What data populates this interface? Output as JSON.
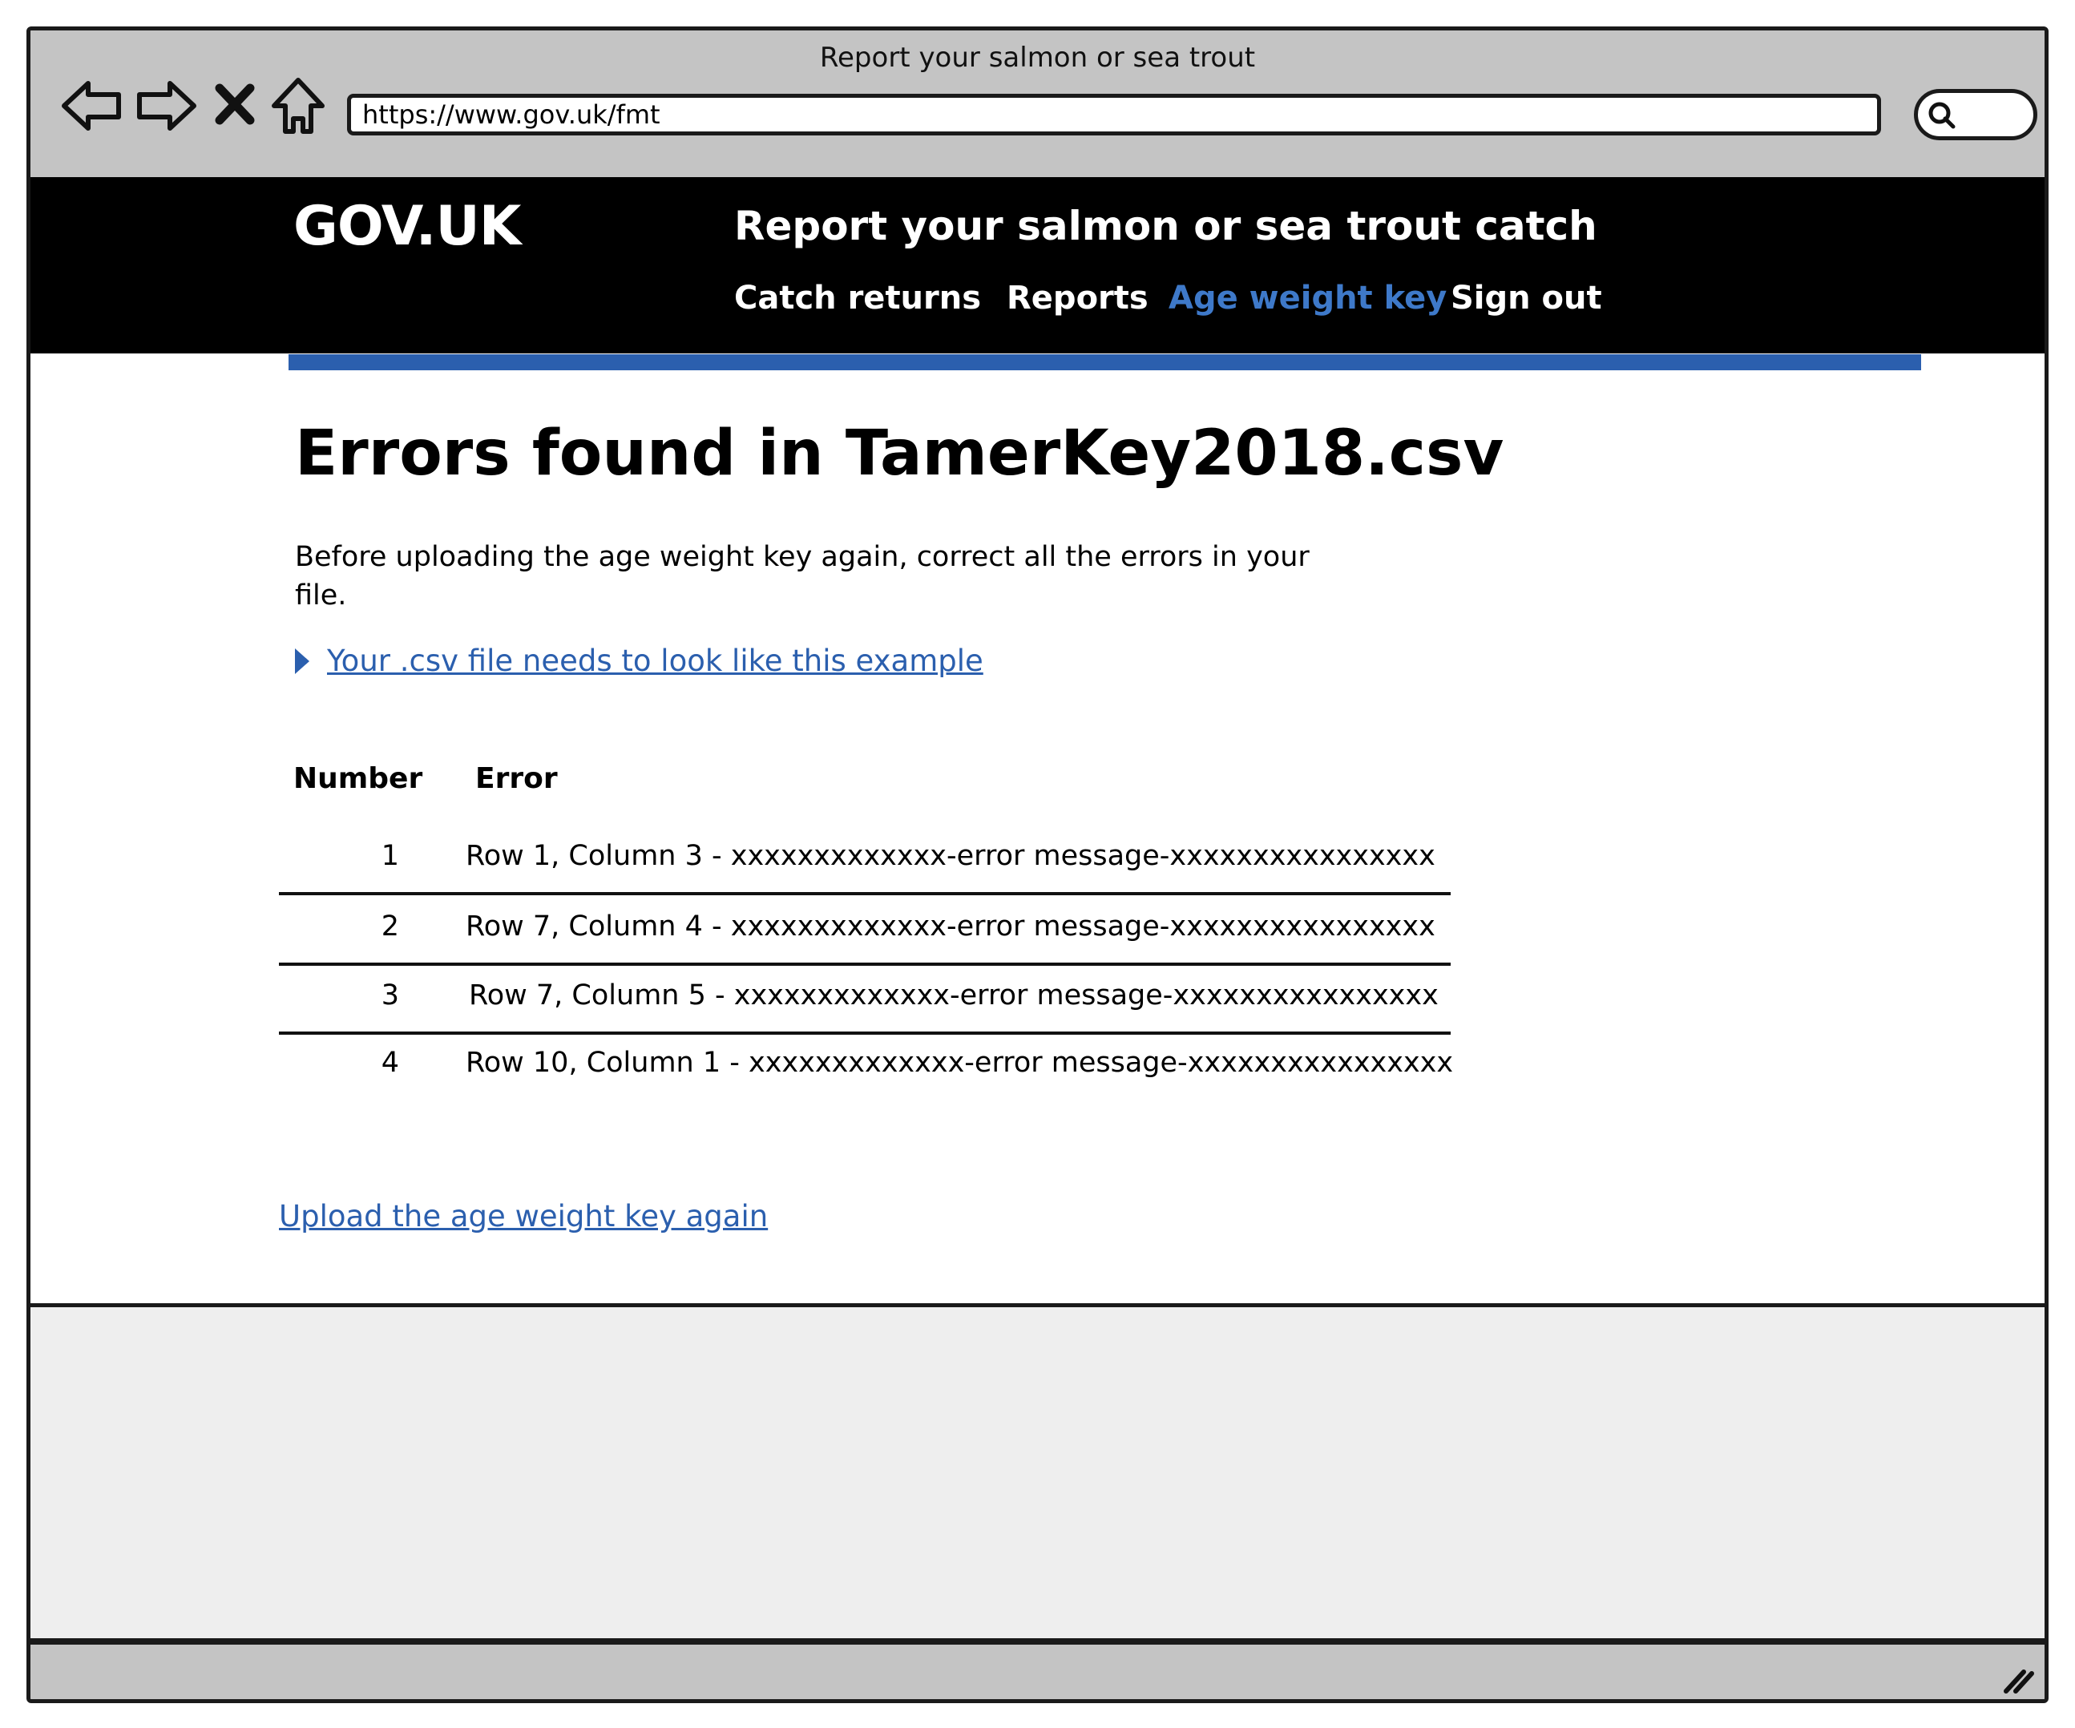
{
  "browser": {
    "window_title": "Report your salmon or sea trout",
    "address": "https://www.gov.uk/fmt"
  },
  "header": {
    "logo": "GOV.UK",
    "service_name": "Report your salmon or sea trout catch",
    "nav": [
      {
        "label": "Catch returns",
        "active": false
      },
      {
        "label": "Reports",
        "active": false
      },
      {
        "label": "Age weight key",
        "active": true
      },
      {
        "label": "Sign out",
        "active": false
      }
    ]
  },
  "main": {
    "heading": "Errors found in TamerKey2018.csv",
    "lead": "Before uploading the age weight key again, correct all the errors in your file.",
    "details_link": "Your .csv file needs to look like this example",
    "table": {
      "headers": [
        "Number",
        "Error"
      ],
      "rows": [
        {
          "number": "1",
          "error": "Row 1, Column 3 - xxxxxxxxxxxxx-error message-xxxxxxxxxxxxxxxx"
        },
        {
          "number": "2",
          "error": "Row 7, Column 4 - xxxxxxxxxxxxx-error message-xxxxxxxxxxxxxxxx"
        },
        {
          "number": "3",
          "error": "Row 7, Column 5 - xxxxxxxxxxxxx-error message-xxxxxxxxxxxxxxxx"
        },
        {
          "number": "4",
          "error": "Row 10, Column 1 - xxxxxxxxxxxxx-error message-xxxxxxxxxxxxxxxx"
        }
      ]
    },
    "upload_link": "Upload the age weight key again"
  },
  "colors": {
    "link": "#2b5fae",
    "active_nav": "#3e79c9",
    "header_bg": "#000000",
    "chrome_bg": "#c4c4c4"
  }
}
